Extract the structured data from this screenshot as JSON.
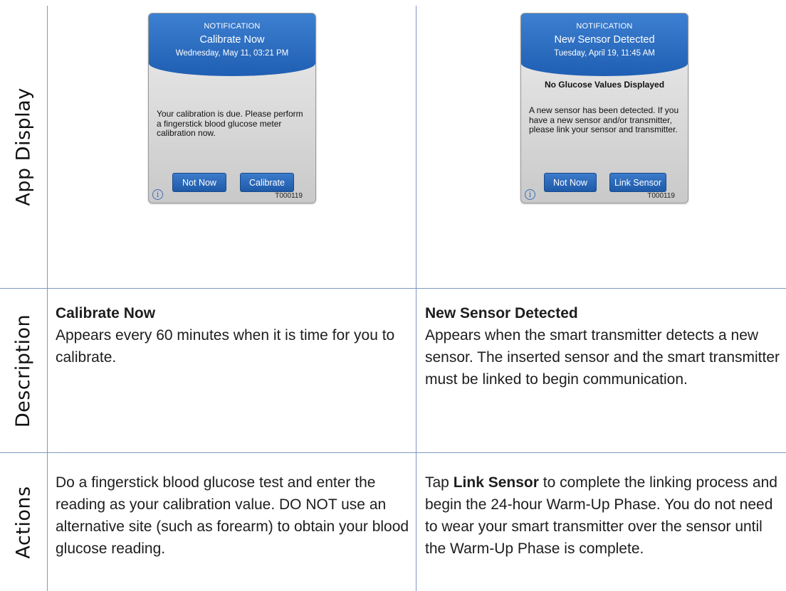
{
  "row_labels": {
    "app_display": "App Display",
    "description": "Description",
    "actions": "Actions"
  },
  "left": {
    "notification": {
      "kind": "NOTIFICATION",
      "title": "Calibrate Now",
      "date": "Wednesday, May 11, 03:21 PM",
      "message": "Your calibration is due. Please perform a fingerstick blood glucose meter calibration now.",
      "button_secondary": "Not Now",
      "button_primary": "Calibrate",
      "info_glyph": "i",
      "code": "T000119"
    },
    "description_title": "Calibrate Now",
    "description_text": "Appears every 60 minutes when it is time for you to calibrate.",
    "actions_text": "Do a fingerstick blood glucose test and enter the reading as your calibration value. DO NOT use an alternative site (such as forearm) to obtain your blood glucose reading."
  },
  "right": {
    "notification": {
      "kind": "NOTIFICATION",
      "title": "New Sensor Detected",
      "date": "Tuesday, April 19, 11:45 AM",
      "subtitle": "No Glucose Values Displayed",
      "message": "A new sensor has been detected. If you have a new sensor and/or transmitter, please link your sensor and transmitter.",
      "button_secondary": "Not Now",
      "button_primary": "Link Sensor",
      "info_glyph": "i",
      "code": "T000119"
    },
    "description_title": "New Sensor Detected",
    "description_text": "Appears when the smart transmitter detects a new sensor. The inserted sensor and the smart transmitter must be linked to begin communication.",
    "actions_prefix": "Tap ",
    "actions_strong": "Link Sensor",
    "actions_suffix": " to complete the linking process and begin the 24-hour Warm-Up Phase. You do not need to wear your smart transmitter over the sensor until the Warm-Up Phase is complete."
  },
  "colors": {
    "grid": "#7f97c3",
    "header_blue": "#2a6cc2",
    "button_blue": "#2a66b8"
  }
}
